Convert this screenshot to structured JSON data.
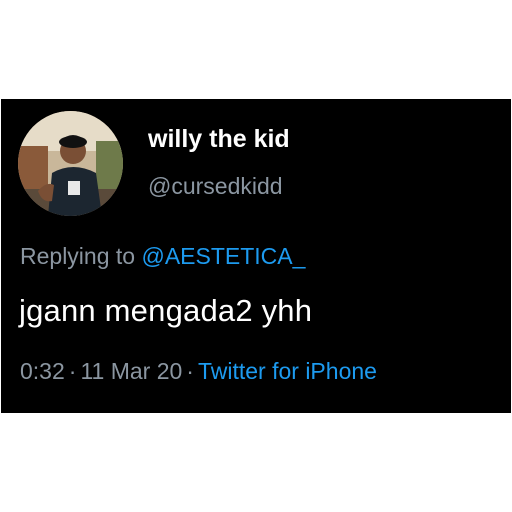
{
  "tweet": {
    "display_name": "willy the kid",
    "handle": "@cursedkidd",
    "replying_prefix": "Replying to",
    "replying_to": "@AESTETICA_",
    "text": "jgann mengada2 yhh",
    "time": "0:32",
    "date": "11 Mar 20",
    "separator": "·",
    "source": "Twitter for iPhone"
  },
  "colors": {
    "background": "#000000",
    "primary_text": "#ffffff",
    "secondary_text": "#8b96a1",
    "accent": "#1d9bf0"
  }
}
